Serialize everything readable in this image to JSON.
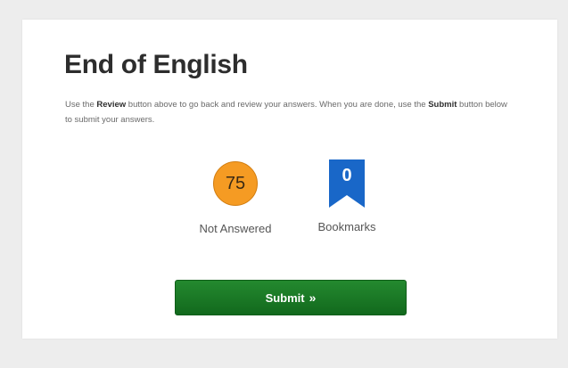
{
  "page": {
    "title": "End of English"
  },
  "instructions": {
    "part1": "Use the ",
    "review_word": "Review",
    "part2": " button above to go back and review your answers. When you are done, use the ",
    "submit_word": "Submit",
    "part3": " button below to submit your answers."
  },
  "status": {
    "not_answered": {
      "count": "75",
      "label": "Not Answered",
      "color": "#f59b23"
    },
    "bookmarks": {
      "count": "0",
      "label": "Bookmarks",
      "color": "#1967c8",
      "icon": "bookmark-icon"
    }
  },
  "actions": {
    "submit_label": "Submit",
    "submit_icon": "double-chevron-right-icon",
    "submit_glyph": "»",
    "submit_color": "#1b7a27"
  }
}
